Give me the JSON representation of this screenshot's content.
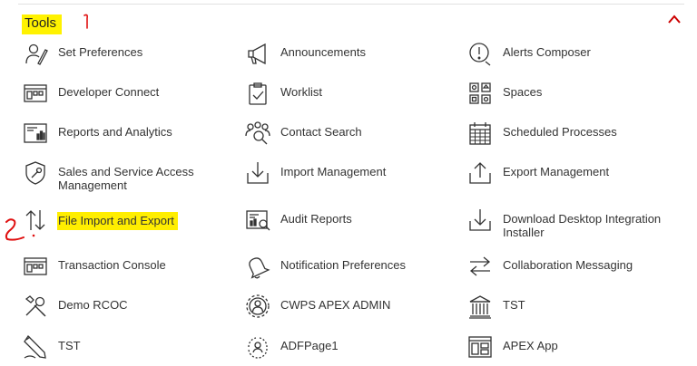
{
  "section": {
    "title": "Tools",
    "collapse_icon": "chevron-up-icon",
    "accent_color": "#cc0000",
    "highlight_color": "#ffee00"
  },
  "items": [
    {
      "label": "Set Preferences",
      "icon": "user-pen-icon"
    },
    {
      "label": "Announcements",
      "icon": "megaphone-icon"
    },
    {
      "label": "Alerts Composer",
      "icon": "alert-icon"
    },
    {
      "label": "Developer Connect",
      "icon": "console-icon"
    },
    {
      "label": "Worklist",
      "icon": "clipboard-check-icon"
    },
    {
      "label": "Spaces",
      "icon": "grid-icon"
    },
    {
      "label": "Reports and Analytics",
      "icon": "report-icon"
    },
    {
      "label": "Contact Search",
      "icon": "contact-search-icon"
    },
    {
      "label": "Scheduled Processes",
      "icon": "calendar-icon"
    },
    {
      "label": "Sales and Service Access Management",
      "icon": "shield-wrench-icon"
    },
    {
      "label": "Import Management",
      "icon": "import-icon"
    },
    {
      "label": "Export Management",
      "icon": "export-icon"
    },
    {
      "label": "File Import and Export",
      "icon": "up-down-arrows-icon"
    },
    {
      "label": "Audit Reports",
      "icon": "audit-report-icon"
    },
    {
      "label": "Download Desktop Integration Installer",
      "icon": "download-icon"
    },
    {
      "label": "Transaction Console",
      "icon": "console-icon"
    },
    {
      "label": "Notification Preferences",
      "icon": "bell-icon"
    },
    {
      "label": "Collaboration Messaging",
      "icon": "swap-arrows-icon"
    },
    {
      "label": "Demo RCOC",
      "icon": "tools-icon"
    },
    {
      "label": "CWPS APEX ADMIN",
      "icon": "gear-user-icon"
    },
    {
      "label": "TST",
      "icon": "building-icon"
    },
    {
      "label": "TST",
      "icon": "pen-icon"
    },
    {
      "label": "ADFPage1",
      "icon": "cycle-user-icon"
    },
    {
      "label": "APEX App",
      "icon": "app-window-icon"
    }
  ]
}
